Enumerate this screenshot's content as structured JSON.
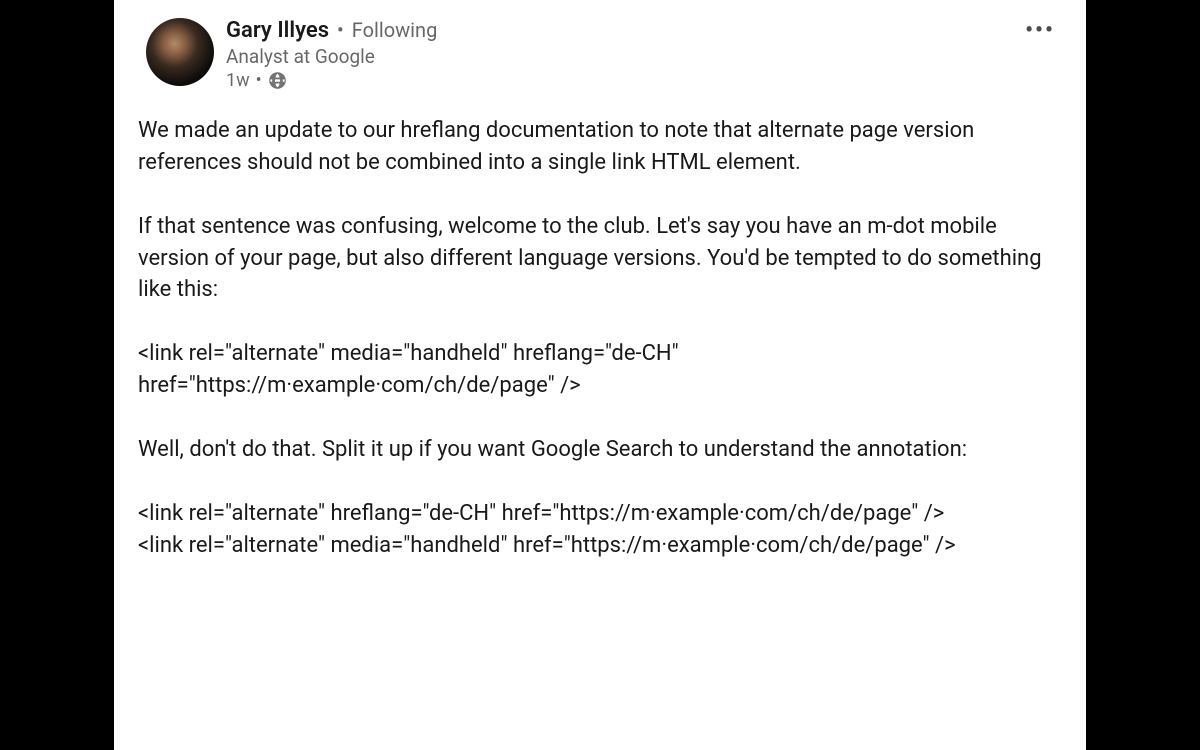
{
  "post": {
    "author": {
      "name": "Gary Illyes",
      "follow_status": "Following",
      "title": "Analyst at Google"
    },
    "time": "1w",
    "separator": "•",
    "visibility": "public",
    "more_label": "•••",
    "body": "We made an update to our hreflang documentation to note that alternate page version references should not be combined into a single link HTML element.\n\nIf that sentence was confusing, welcome to the club. Let's say you have an m-dot mobile version of your page, but also different language versions. You'd be tempted to do something like this:\n\n<link rel=\"alternate\" media=\"handheld\" hreflang=\"de-CH\" href=\"https://m·example·com/ch/de/page\" />\n\nWell, don't do that. Split it up if you want Google Search to understand the annotation:\n\n<link rel=\"alternate\" hreflang=\"de-CH\" href=\"https://m·example·com/ch/de/page\" />\n<link rel=\"alternate\" media=\"handheld\" href=\"https://m·example·com/ch/de/page\" />"
  }
}
